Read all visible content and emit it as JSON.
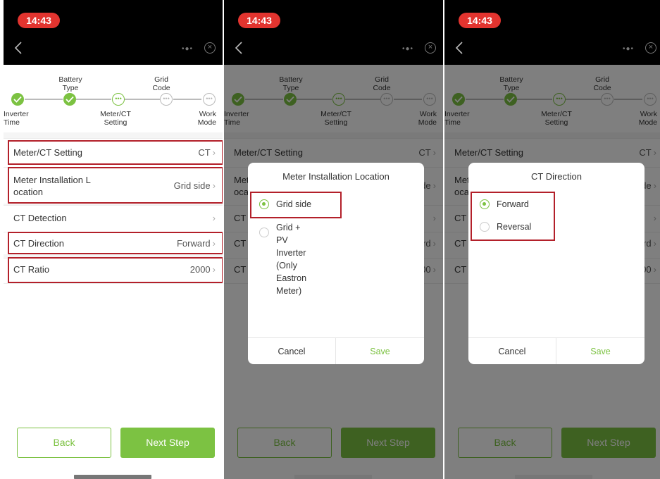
{
  "status_time": "14:43",
  "steps": {
    "labels": [
      "Inverter\nTime",
      "Battery\nType",
      "Meter/CT\nSetting",
      "Grid\nCode",
      "Work\nMode"
    ]
  },
  "settings": [
    {
      "label": "Meter/CT Setting",
      "value": "CT"
    },
    {
      "label": "Meter Installation L\nocation",
      "value": "Grid side"
    },
    {
      "label": "CT Detection",
      "value": ""
    },
    {
      "label": "CT Direction",
      "value": "Forward"
    },
    {
      "label": "CT Ratio",
      "value": "2000"
    }
  ],
  "buttons": {
    "back": "Back",
    "next": "Next Step"
  },
  "partial": {
    "row2_left": "Met\noca",
    "row3_left": "CT",
    "row4_left": "CT",
    "row5_left": "CT",
    "row2_right": "de",
    "row4_right": "rd",
    "row5_right": "00"
  },
  "dialog_location": {
    "title": "Meter Installation Location",
    "options": [
      {
        "label": "Grid side",
        "selected": true
      },
      {
        "label": "Grid + PV Inverter\n(Only Eastron Meter)",
        "selected": false
      }
    ],
    "cancel": "Cancel",
    "save": "Save"
  },
  "dialog_direction": {
    "title": "CT Direction",
    "options": [
      {
        "label": "Forward",
        "selected": true
      },
      {
        "label": "Reversal",
        "selected": false
      }
    ],
    "cancel": "Cancel",
    "save": "Save"
  },
  "colors": {
    "accent": "#7cc242",
    "highlight": "#b3202a",
    "status_pill": "#e2342f"
  }
}
